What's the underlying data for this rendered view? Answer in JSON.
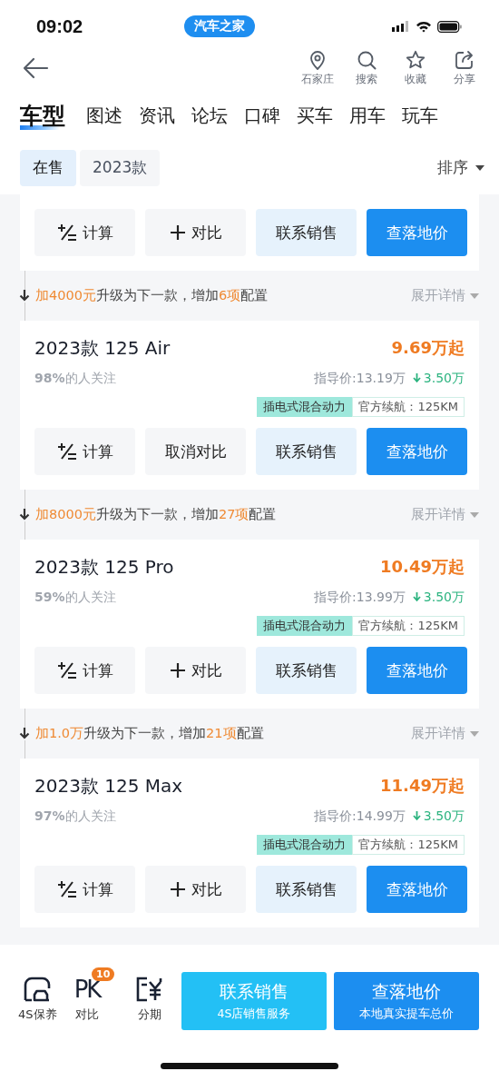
{
  "status_bar": {
    "time": "09:02",
    "app_badge": "汽车之家"
  },
  "nav": {
    "actions": [
      {
        "kind": "location",
        "label": "石家庄"
      },
      {
        "kind": "search",
        "label": "搜索"
      },
      {
        "kind": "star",
        "label": "收藏"
      },
      {
        "kind": "share",
        "label": "分享"
      }
    ]
  },
  "tabs": [
    {
      "label": "车型",
      "selected": true
    },
    {
      "label": "图述",
      "selected": false
    },
    {
      "label": "资讯",
      "selected": false
    },
    {
      "label": "论坛",
      "selected": false
    },
    {
      "label": "口碑",
      "selected": false
    },
    {
      "label": "买车",
      "selected": false
    },
    {
      "label": "用车",
      "selected": false
    },
    {
      "label": "玩车",
      "selected": false
    }
  ],
  "filters": [
    {
      "label": "在售",
      "selected": true
    },
    {
      "label": "2023款",
      "selected": false
    }
  ],
  "sort": {
    "label": "排序"
  },
  "list": [
    {
      "kind": "card",
      "partial": true,
      "compared": false,
      "buttons": [
        "计算",
        "对比",
        "联系销售",
        "查落地价"
      ]
    },
    {
      "kind": "upgrade",
      "segments": [
        {
          "text": "加",
          "highlight": true
        },
        {
          "text": "4000元",
          "highlight": true
        },
        {
          "text": "升级为下一款，增加",
          "highlight": false
        },
        {
          "text": "6项",
          "highlight": true
        },
        {
          "text": "配置",
          "highlight": false
        }
      ],
      "expand": "展开详情"
    },
    {
      "kind": "card",
      "partial": false,
      "name": "2023款 125 Air",
      "price": "9.69万起",
      "interest": "98%",
      "interest_label": "的人关注",
      "guide_price": "指导价:13.19万",
      "discount": "3.50万",
      "tags": [
        "插电式混合动力",
        "官方续航：125KM"
      ],
      "compared": true,
      "buttons": [
        "计算",
        "取消对比",
        "联系销售",
        "查落地价"
      ]
    },
    {
      "kind": "upgrade",
      "segments": [
        {
          "text": "加",
          "highlight": true
        },
        {
          "text": "8000元",
          "highlight": true
        },
        {
          "text": "升级为下一款，增加",
          "highlight": false
        },
        {
          "text": "27项",
          "highlight": true
        },
        {
          "text": "配置",
          "highlight": false
        }
      ],
      "expand": "展开详情"
    },
    {
      "kind": "card",
      "partial": false,
      "name": "2023款 125 Pro",
      "price": "10.49万起",
      "interest": "59%",
      "interest_label": "的人关注",
      "guide_price": "指导价:13.99万",
      "discount": "3.50万",
      "tags": [
        "插电式混合动力",
        "官方续航：125KM"
      ],
      "compared": false,
      "buttons": [
        "计算",
        "对比",
        "联系销售",
        "查落地价"
      ]
    },
    {
      "kind": "upgrade",
      "segments": [
        {
          "text": "加",
          "highlight": true
        },
        {
          "text": "1.0万",
          "highlight": true
        },
        {
          "text": "升级为下一款，增加",
          "highlight": false
        },
        {
          "text": "21项",
          "highlight": true
        },
        {
          "text": "配置",
          "highlight": false
        }
      ],
      "expand": "展开详情"
    },
    {
      "kind": "card",
      "partial": false,
      "name": "2023款 125 Max",
      "price": "11.49万起",
      "interest": "97%",
      "interest_label": "的人关注",
      "guide_price": "指导价:14.99万",
      "discount": "3.50万",
      "tags": [
        "插电式混合动力",
        "官方续航：125KM"
      ],
      "compared": false,
      "buttons": [
        "计算",
        "对比",
        "联系销售",
        "查落地价"
      ]
    }
  ],
  "bottom_bar": {
    "items": [
      {
        "kind": "maintenance",
        "label": "4S保养"
      },
      {
        "kind": "pk",
        "label": "对比",
        "icon_text": "PK",
        "badge": "10"
      },
      {
        "kind": "installment",
        "label": "分期"
      }
    ],
    "buttons": [
      {
        "kind": "contact",
        "title": "联系销售",
        "subtitle": "4S店销售服务"
      },
      {
        "kind": "price",
        "title": "查落地价",
        "subtitle": "本地真实提车总价"
      }
    ]
  }
}
